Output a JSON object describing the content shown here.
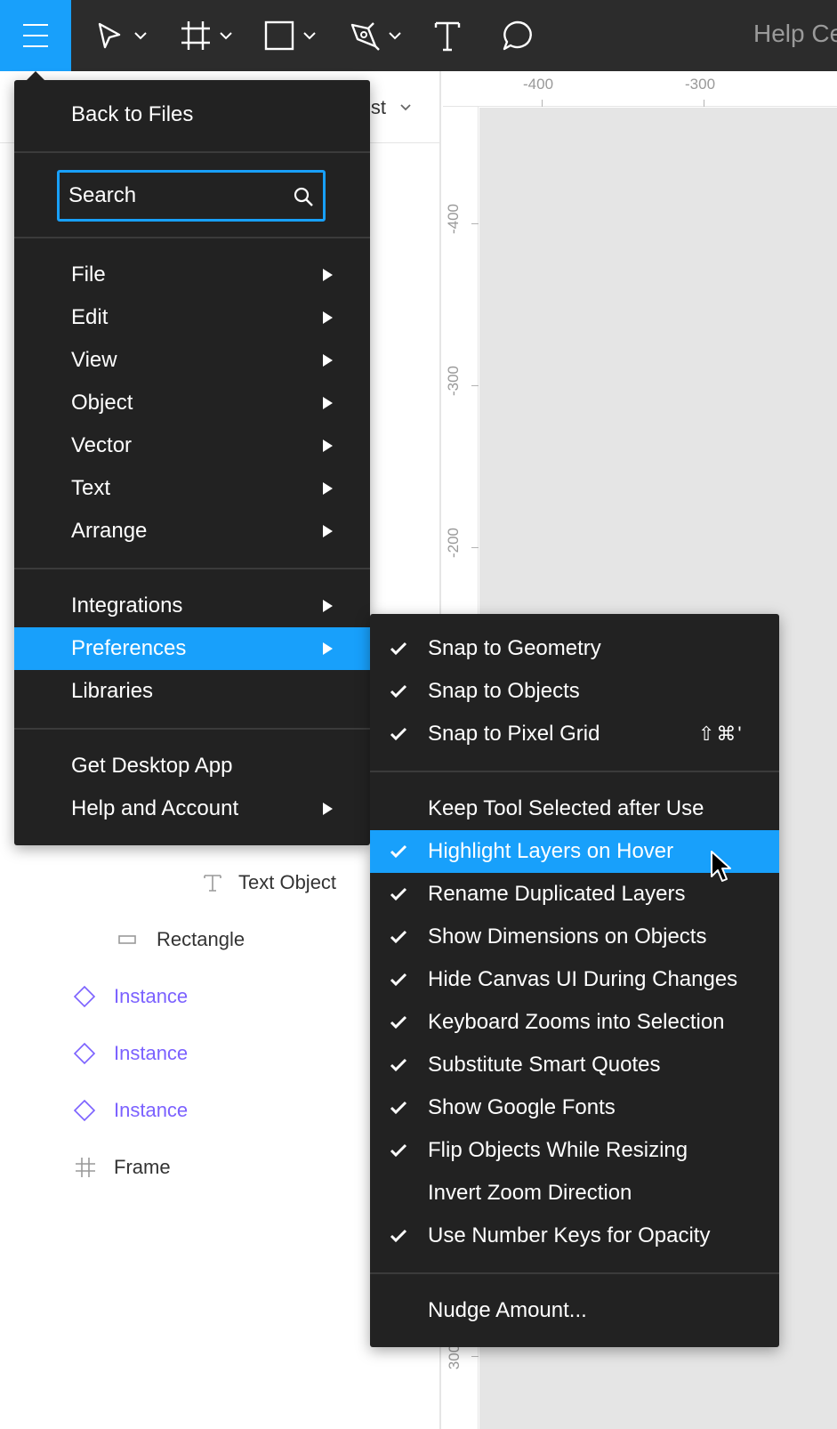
{
  "toolbar": {
    "menu_button": "main-menu",
    "tools": [
      "move-tool",
      "frame-tool",
      "rectangle-tool",
      "pen-tool",
      "text-tool",
      "comment-tool"
    ],
    "help_link": "Help Ce",
    "accent": "#18a0fb",
    "background": "#2c2c2c"
  },
  "layers_panel": {
    "header_partial": "ist",
    "rows": [
      {
        "label": "Text Object",
        "icon": "text-icon",
        "type": "text"
      },
      {
        "label": "Rectangle",
        "icon": "rectangle-icon",
        "type": "rectangle"
      },
      {
        "label": "Instance",
        "icon": "instance-icon",
        "type": "instance"
      },
      {
        "label": "Instance",
        "icon": "instance-icon",
        "type": "instance"
      },
      {
        "label": "Instance",
        "icon": "instance-icon",
        "type": "instance"
      },
      {
        "label": "Frame",
        "icon": "frame-icon",
        "type": "frame"
      }
    ],
    "instance_color": "#7b61ff"
  },
  "rulers": {
    "top": [
      "-400",
      "-300"
    ],
    "left": [
      "-400",
      "-300",
      "-200",
      "300"
    ]
  },
  "main_menu": {
    "back": "Back to Files",
    "search": {
      "placeholder": "Search",
      "value": ""
    },
    "items": [
      {
        "label": "File",
        "submenu": true
      },
      {
        "label": "Edit",
        "submenu": true
      },
      {
        "label": "View",
        "submenu": true
      },
      {
        "label": "Object",
        "submenu": true
      },
      {
        "label": "Vector",
        "submenu": true
      },
      {
        "label": "Text",
        "submenu": true
      },
      {
        "label": "Arrange",
        "submenu": true
      }
    ],
    "group2": [
      {
        "label": "Integrations",
        "submenu": true
      },
      {
        "label": "Preferences",
        "submenu": true,
        "active": true
      },
      {
        "label": "Libraries",
        "submenu": false
      }
    ],
    "group3": [
      {
        "label": "Get Desktop App",
        "submenu": false
      },
      {
        "label": "Help and Account",
        "submenu": true
      }
    ],
    "background": "#222222"
  },
  "preferences_menu": {
    "snap": [
      {
        "label": "Snap to Geometry",
        "checked": true
      },
      {
        "label": "Snap to Objects",
        "checked": true
      },
      {
        "label": "Snap to Pixel Grid",
        "checked": true,
        "shortcut": "⇧⌘'"
      }
    ],
    "options": [
      {
        "label": "Keep Tool Selected after Use",
        "checked": false
      },
      {
        "label": "Highlight Layers on Hover",
        "checked": true,
        "active": true
      },
      {
        "label": "Rename Duplicated Layers",
        "checked": true
      },
      {
        "label": "Show Dimensions on Objects",
        "checked": true
      },
      {
        "label": "Hide Canvas UI During Changes",
        "checked": true
      },
      {
        "label": "Keyboard Zooms into Selection",
        "checked": true
      },
      {
        "label": "Substitute Smart Quotes",
        "checked": true
      },
      {
        "label": "Show Google Fonts",
        "checked": true
      },
      {
        "label": "Flip Objects While Resizing",
        "checked": true
      },
      {
        "label": "Invert Zoom Direction",
        "checked": false
      },
      {
        "label": "Use Number Keys for Opacity",
        "checked": true
      }
    ],
    "nudge": "Nudge Amount..."
  }
}
